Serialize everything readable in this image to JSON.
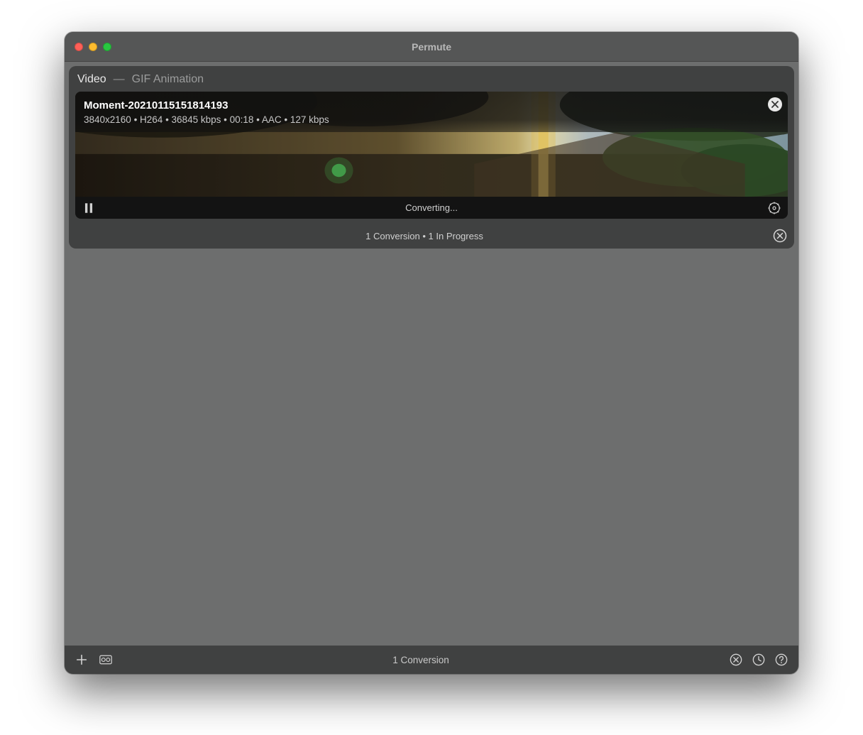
{
  "window": {
    "title": "Permute"
  },
  "group": {
    "category": "Video",
    "separator": "—",
    "preset": "GIF Animation",
    "summary": "1 Conversion  •  1 In Progress"
  },
  "item": {
    "title": "Moment-20210115151814193",
    "meta": "3840x2160 • H264 • 36845 kbps • 00:18 • AAC • 127 kbps",
    "status": "Converting..."
  },
  "bottombar": {
    "summary": "1 Conversion"
  }
}
